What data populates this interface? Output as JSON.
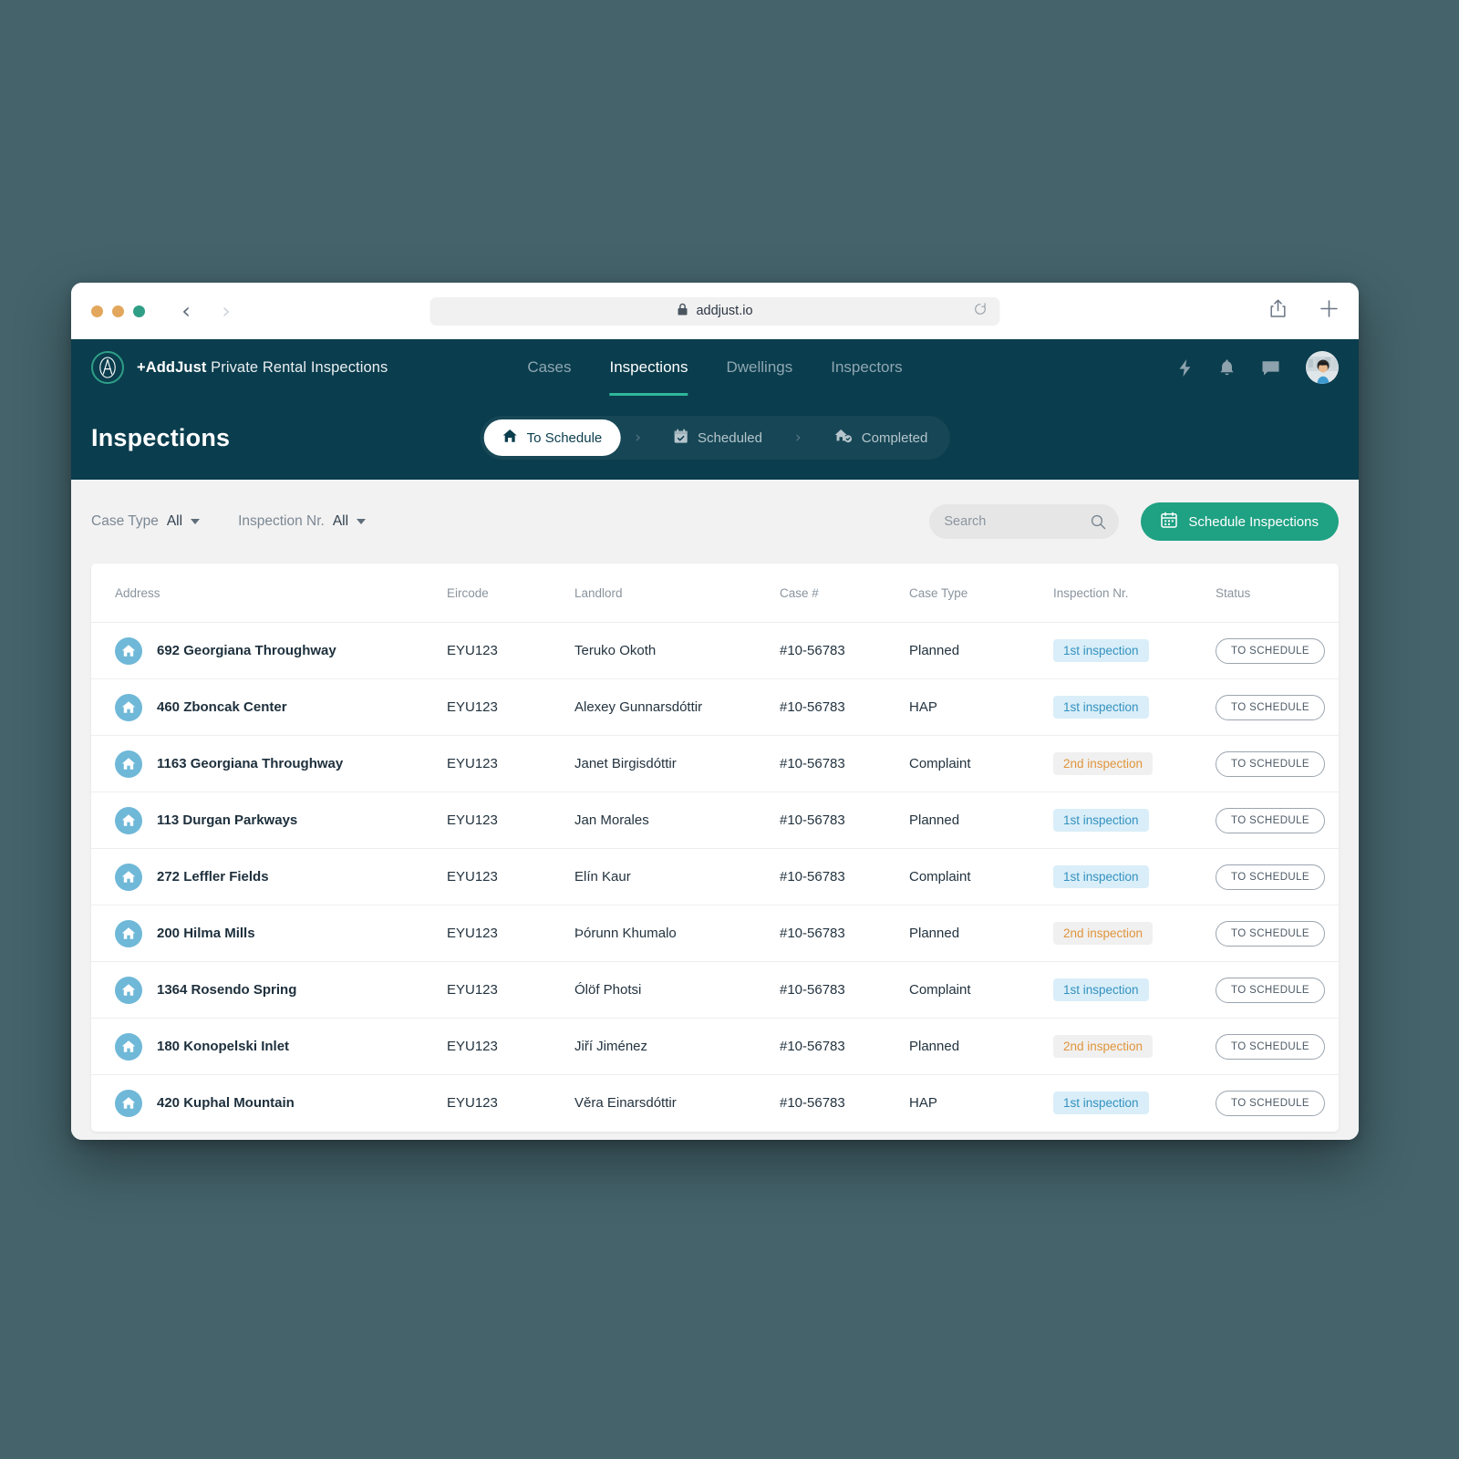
{
  "browser": {
    "url": "addjust.io",
    "lock_icon": "lock-icon",
    "reload_icon": "reload-icon",
    "back_icon": "chevron-left-icon",
    "forward_icon": "chevron-right-icon",
    "share_icon": "share-icon",
    "new_tab_icon": "plus-icon",
    "traffic_lights": [
      "close",
      "minimize",
      "zoom"
    ]
  },
  "appnav": {
    "brand_bold": "+AddJust",
    "brand_rest": " Private Rental Inspections",
    "logo_icon": "adjust-a-logo-icon",
    "links": [
      {
        "label": "Cases",
        "active": false
      },
      {
        "label": "Inspections",
        "active": true
      },
      {
        "label": "Dwellings",
        "active": false
      },
      {
        "label": "Inspectors",
        "active": false
      }
    ],
    "actions": [
      {
        "icon": "lightning-bolt-icon"
      },
      {
        "icon": "bell-icon"
      },
      {
        "icon": "chat-bubble-icon"
      },
      {
        "icon": "avatar"
      }
    ]
  },
  "page": {
    "title": "Inspections",
    "steps": [
      {
        "label": "To Schedule",
        "icon": "home-icon",
        "active": true
      },
      {
        "label": "Scheduled",
        "icon": "calendar-check-icon",
        "active": false
      },
      {
        "label": "Completed",
        "icon": "home-check-icon",
        "active": false
      }
    ],
    "separator": "›"
  },
  "toolbar": {
    "filters": [
      {
        "label": "Case Type",
        "value": "All"
      },
      {
        "label": "Inspection Nr.",
        "value": "All"
      }
    ],
    "search_placeholder": "Search",
    "search_value": "",
    "search_icon": "search-icon",
    "schedule_button": "Schedule Inspections",
    "schedule_icon": "calendar-icon"
  },
  "table": {
    "columns": [
      "Address",
      "Eircode",
      "Landlord",
      "Case #",
      "Case Type",
      "Inspection Nr.",
      "Status"
    ],
    "rows": [
      {
        "address": "692 Georgiana Throughway",
        "eircode": "EYU123",
        "landlord": "Teruko Okoth",
        "case": "#10-56783",
        "case_type": "Planned",
        "inspection": "1st inspection",
        "inspection_kind": "first",
        "status": "TO SCHEDULE"
      },
      {
        "address": "460 Zboncak Center",
        "eircode": "EYU123",
        "landlord": "Alexey Gunnarsdóttir",
        "case": "#10-56783",
        "case_type": "HAP",
        "inspection": "1st inspection",
        "inspection_kind": "first",
        "status": "TO SCHEDULE"
      },
      {
        "address": "1163 Georgiana Throughway",
        "eircode": "EYU123",
        "landlord": "Janet Birgisdóttir",
        "case": "#10-56783",
        "case_type": "Complaint",
        "inspection": "2nd inspection",
        "inspection_kind": "second",
        "status": "TO SCHEDULE"
      },
      {
        "address": "113 Durgan Parkways",
        "eircode": "EYU123",
        "landlord": "Jan Morales",
        "case": "#10-56783",
        "case_type": "Planned",
        "inspection": "1st inspection",
        "inspection_kind": "first",
        "status": "TO SCHEDULE"
      },
      {
        "address": "272 Leffler Fields",
        "eircode": "EYU123",
        "landlord": "Elín Kaur",
        "case": "#10-56783",
        "case_type": "Complaint",
        "inspection": "1st inspection",
        "inspection_kind": "first",
        "status": "TO SCHEDULE"
      },
      {
        "address": "200 Hilma Mills",
        "eircode": "EYU123",
        "landlord": "Þórunn Khumalo",
        "case": "#10-56783",
        "case_type": "Planned",
        "inspection": "2nd inspection",
        "inspection_kind": "second",
        "status": "TO SCHEDULE"
      },
      {
        "address": "1364 Rosendo Spring",
        "eircode": "EYU123",
        "landlord": "Ólöf Photsi",
        "case": "#10-56783",
        "case_type": "Complaint",
        "inspection": "1st inspection",
        "inspection_kind": "first",
        "status": "TO SCHEDULE"
      },
      {
        "address": "180 Konopelski Inlet",
        "eircode": "EYU123",
        "landlord": "Jiří Jiménez",
        "case": "#10-56783",
        "case_type": "Planned",
        "inspection": "2nd inspection",
        "inspection_kind": "second",
        "status": "TO SCHEDULE"
      },
      {
        "address": "420 Kuphal Mountain",
        "eircode": "EYU123",
        "landlord": "Věra Einarsdóttir",
        "case": "#10-56783",
        "case_type": "HAP",
        "inspection": "1st inspection",
        "inspection_kind": "first",
        "status": "TO SCHEDULE"
      }
    ]
  },
  "colors": {
    "page_background": "#44636b",
    "nav_dark": "#0a3d4d",
    "accent_green": "#1fa183",
    "accent_teal_underline": "#2fb79a",
    "house_badge_blue": "#6fb8d8",
    "pill_first_bg": "#d9eef8",
    "pill_first_text": "#3491c0",
    "pill_second_bg": "#f0f0f0",
    "pill_second_text": "#e0953c",
    "content_background": "#f2f2f2"
  }
}
